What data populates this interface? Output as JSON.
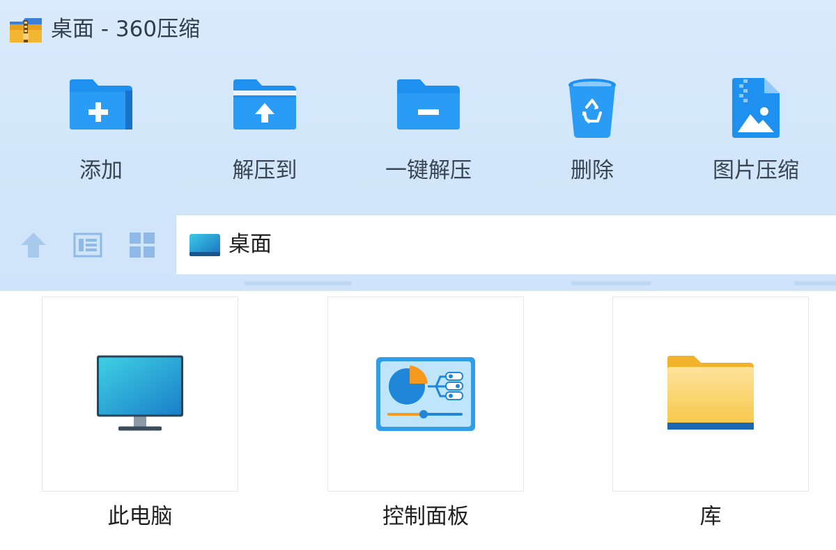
{
  "window": {
    "title": "桌面 - 360压缩"
  },
  "toolbar": {
    "items": [
      {
        "id": "add",
        "label": "添加",
        "icon": "folder-plus-icon"
      },
      {
        "id": "extract_to",
        "label": "解压到",
        "icon": "folder-upload-icon"
      },
      {
        "id": "one_click_extract",
        "label": "一键解压",
        "icon": "folder-minus-icon"
      },
      {
        "id": "delete",
        "label": "删除",
        "icon": "recycle-bin-icon"
      },
      {
        "id": "image_compress",
        "label": "图片压缩",
        "icon": "zip-image-icon"
      }
    ]
  },
  "navigation": {
    "up_icon": "arrow-up-icon",
    "view_details_icon": "list-view-icon",
    "view_thumbnails_icon": "grid-view-icon"
  },
  "address_bar": {
    "path": "桌面",
    "icon": "desktop-icon"
  },
  "files": [
    {
      "name": "此电脑",
      "icon": "monitor-icon"
    },
    {
      "name": "控制面板",
      "icon": "control-panel-icon"
    },
    {
      "name": "库",
      "icon": "folder-icon"
    }
  ],
  "colors": {
    "header_bg": "#d3e7fb",
    "accent_blue": "#1e90f0",
    "nav_icon": "#9cc3ea",
    "folder_yellow": "#f7c948"
  }
}
